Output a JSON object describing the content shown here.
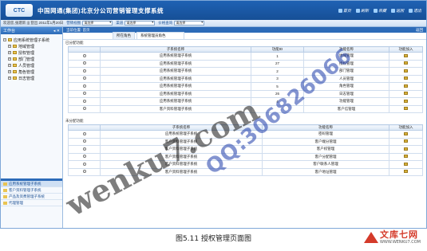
{
  "header": {
    "logo": "CTC",
    "title": "中国网通(集团)北京分公司营销管理支撑系统",
    "links": [
      "首页",
      "刷新",
      "收藏",
      "返回",
      "退出"
    ]
  },
  "toolbar": {
    "user_info": "欢迎您,张建新 ||| 登出 2011年1月20日",
    "selects": [
      {
        "label": "营销视图",
        "value": "请选择"
      },
      {
        "label": "渠道",
        "value": "请选择"
      },
      {
        "label": "价格查询",
        "value": "请选择"
      }
    ]
  },
  "sidebar": {
    "title": "工作台",
    "tree": [
      {
        "label": "应用系统管理子系统",
        "expanded": true
      },
      {
        "label": "地域管理"
      },
      {
        "label": "授权管理"
      },
      {
        "label": "部门管理"
      },
      {
        "label": "人员管理"
      },
      {
        "label": "角色管理"
      },
      {
        "label": "日志管理"
      }
    ],
    "modules": [
      {
        "label": "应用系统管理子系统",
        "active": true
      },
      {
        "label": "客户资料管理子系统"
      },
      {
        "label": "产品及资费管理子系统"
      },
      {
        "label": "代理管理"
      }
    ]
  },
  "main": {
    "breadcrumb": "当前位置: 首页",
    "close": "返回",
    "role_label": "所在角色",
    "role_value": "系统管理员角色",
    "assigned_title": "已分配功能",
    "unassigned_title": "未分配功能",
    "assigned_headers": [
      "",
      "子系统名称",
      "功能ID",
      "功能名称",
      "功能加入"
    ],
    "assigned_rows": [
      {
        "sub": "应用系统管理子系统",
        "id": "1",
        "name": "地域管理"
      },
      {
        "sub": "应用系统管理子系统",
        "id": "27",
        "name": "授权管理"
      },
      {
        "sub": "应用系统管理子系统",
        "id": "2",
        "name": "部门管理"
      },
      {
        "sub": "应用系统管理子系统",
        "id": "3",
        "name": "人员管理"
      },
      {
        "sub": "应用系统管理子系统",
        "id": "5",
        "name": "角色管理"
      },
      {
        "sub": "应用系统管理子系统",
        "id": "26",
        "name": "日志管理"
      },
      {
        "sub": "应用系统管理子系统",
        "id": "4",
        "name": "功能管理"
      },
      {
        "sub": "客户资料管理子系统",
        "id": "",
        "name": "客户信管理"
      }
    ],
    "unassigned_headers": [
      "",
      "子系统名称",
      "功能名称",
      "功能加入"
    ],
    "unassigned_rows": [
      {
        "sub": "应用系统管理子系统",
        "name": "密码管理"
      },
      {
        "sub": "客户资料管理子系统",
        "name": "客户端分管理"
      },
      {
        "sub": "客户资料管理子系统",
        "name": "客户权管理"
      },
      {
        "sub": "客户资料管理子系统",
        "name": "客户分配管理"
      },
      {
        "sub": "客户资料管理子系统",
        "name": "客户联系人管理"
      },
      {
        "sub": "客户资料管理子系统",
        "name": "客户地址管理"
      }
    ]
  },
  "caption": "图5.11  授权管理页面图",
  "brand": {
    "name": "文库七网",
    "url": "WWW.WENKU7.COM"
  },
  "watermarks": [
    "wenku7.com",
    "QQ:306826066"
  ],
  "colors": {
    "header": "#1f62b4",
    "accent": "#2c6bb8",
    "brand_red": "#d43a2a"
  }
}
